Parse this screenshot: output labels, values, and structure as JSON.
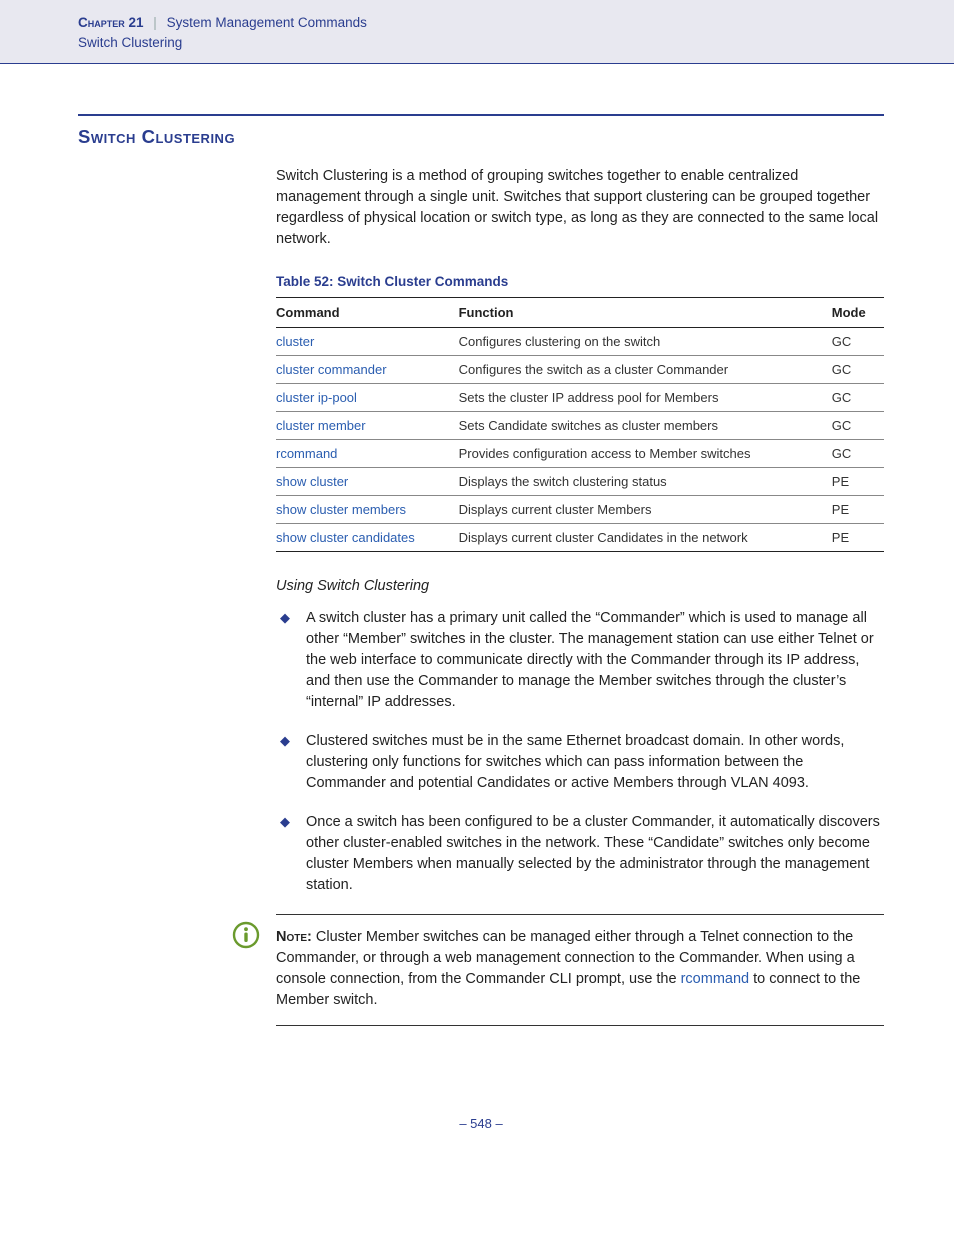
{
  "header": {
    "chapter": "Chapter 21",
    "pipe": "|",
    "section": "System Management Commands",
    "sub": "Switch Clustering"
  },
  "title": "Switch Clustering",
  "intro": "Switch Clustering is a method of grouping switches together to enable centralized management through a single unit. Switches that support clustering can be grouped together regardless of physical location or switch type, as long as they are connected to the same local network.",
  "table": {
    "caption": "Table 52: Switch Cluster Commands",
    "headers": {
      "c1": "Command",
      "c2": "Function",
      "c3": "Mode"
    },
    "rows": [
      {
        "cmd": "cluster",
        "fn": "Configures clustering on the switch",
        "mode": "GC"
      },
      {
        "cmd": "cluster commander",
        "fn": "Configures the switch as a cluster Commander",
        "mode": "GC"
      },
      {
        "cmd": "cluster ip-pool",
        "fn": "Sets the cluster IP address pool for Members",
        "mode": "GC"
      },
      {
        "cmd": "cluster member",
        "fn": "Sets Candidate switches as cluster members",
        "mode": "GC"
      },
      {
        "cmd": "rcommand",
        "fn": "Provides configuration access to Member switches",
        "mode": "GC"
      },
      {
        "cmd": "show cluster",
        "fn": "Displays the switch clustering status",
        "mode": "PE"
      },
      {
        "cmd": "show cluster members",
        "fn": "Displays current cluster Members",
        "mode": "PE"
      },
      {
        "cmd": "show cluster candidates",
        "fn": "Displays current cluster Candidates in the network",
        "mode": "PE"
      }
    ]
  },
  "subhead": "Using Switch Clustering",
  "bullets": [
    "A switch cluster has a primary unit called the “Commander” which is used to manage all other “Member” switches in the cluster. The management station can use either Telnet or the web interface to communicate directly with the Commander through its IP address, and then use the Commander to manage the Member switches through the cluster’s “internal” IP addresses.",
    "Clustered switches must be in the same Ethernet broadcast domain. In other words, clustering only functions for switches which can pass information between the Commander and potential Candidates or active Members through VLAN 4093.",
    "Once a switch has been configured to be a cluster Commander, it automatically discovers other cluster-enabled switches in the network. These “Candidate” switches only become cluster Members when manually selected by the administrator through the management station."
  ],
  "note": {
    "label": "Note:",
    "pre": " Cluster Member switches can be managed either through a Telnet connection to the Commander, or through a web management connection to the Commander. When using a console connection, from the Commander CLI prompt, use the ",
    "link": "rcommand",
    "post": " to connect to the Member switch."
  },
  "footer": "–  548  –"
}
